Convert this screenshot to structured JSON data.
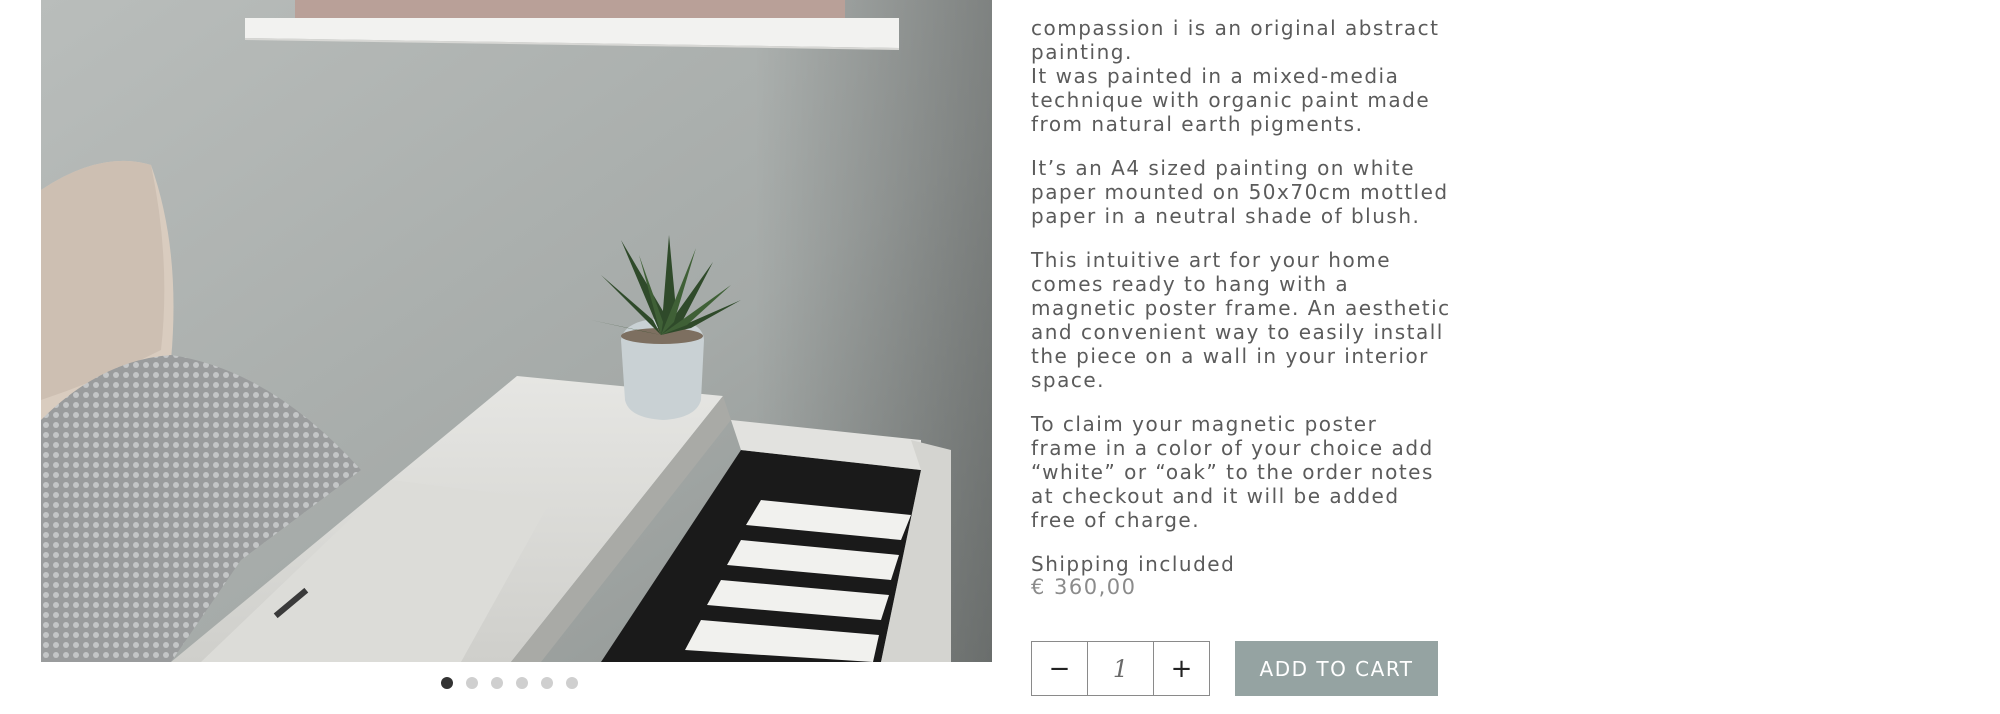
{
  "product": {
    "image_alt": "Abstract painting above a white piano with a potted plant",
    "carousel": {
      "dots": 6,
      "active_index": 0
    },
    "description": [
      "compassion i is an original abstract painting.\nIt was painted in a mixed-media technique with organic paint made from natural earth pigments.",
      "It’s an A4 sized painting on white paper mounted on 50x70cm mottled paper in a neutral shade of blush.",
      "This intuitive art for your home comes ready to hang with a magnetic poster frame. An aesthetic and convenient way to easily install the piece on a wall in your interior space.",
      "To claim your magnetic poster frame in a color of your choice add “white” or “oak” to the order notes at checkout and it will be added free of charge.",
      "Shipping included"
    ],
    "price": "€ 360,00",
    "quantity": "1",
    "decrement_icon": "minus-icon",
    "increment_icon": "plus-icon",
    "add_to_cart_label": "ADD TO CART"
  },
  "colors": {
    "button_bg": "#95a3a2",
    "text": "#5b5b5b",
    "price": "#8b8b8b"
  }
}
